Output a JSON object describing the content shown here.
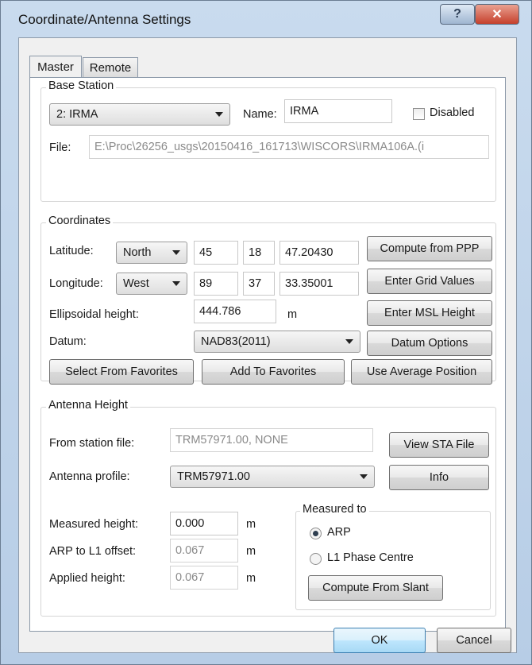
{
  "window": {
    "title": "Coordinate/Antenna Settings",
    "help_glyph": "?",
    "close_glyph": "✕"
  },
  "tabs": [
    {
      "label": "Master",
      "active": true
    },
    {
      "label": "Remote",
      "active": false
    }
  ],
  "base_station": {
    "group_label": "Base Station",
    "station_select": "2: IRMA",
    "name_label": "Name:",
    "name_value": "IRMA",
    "disabled_label": "Disabled",
    "disabled_checked": false,
    "file_label": "File:",
    "file_value": "E:\\Proc\\26256_usgs\\20150416_161713\\WISCORS\\IRMA106A.(i"
  },
  "coordinates": {
    "group_label": "Coordinates",
    "latitude_label": "Latitude:",
    "lat_hemisphere": "North",
    "lat_deg": "45",
    "lat_min": "18",
    "lat_sec": "47.20430",
    "longitude_label": "Longitude:",
    "lon_hemisphere": "West",
    "lon_deg": "89",
    "lon_min": "37",
    "lon_sec": "33.35001",
    "ellipsoidal_label": "Ellipsoidal height:",
    "ellipsoidal_value": "444.786",
    "ellipsoidal_unit": "m",
    "datum_label": "Datum:",
    "datum_value": "NAD83(2011)",
    "compute_ppp": "Compute from PPP",
    "enter_grid": "Enter Grid Values",
    "enter_msl": "Enter MSL Height",
    "datum_options": "Datum Options",
    "select_favorites": "Select From Favorites",
    "add_favorites": "Add To Favorites",
    "use_average": "Use Average Position"
  },
  "antenna": {
    "group_label": "Antenna Height",
    "from_station_label": "From station file:",
    "from_station_value": "TRM57971.00, NONE",
    "view_sta": "View STA File",
    "profile_label": "Antenna profile:",
    "profile_value": "TRM57971.00",
    "info": "Info",
    "measured_label": "Measured height:",
    "measured_value": "0.000",
    "arp_label": "ARP to L1 offset:",
    "arp_value": "0.067",
    "applied_label": "Applied height:",
    "applied_value": "0.067",
    "unit": "m",
    "measured_to_label": "Measured to",
    "radio_arp": "ARP",
    "radio_l1": "L1 Phase Centre",
    "radio_selected": "ARP",
    "compute_slant": "Compute From Slant"
  },
  "footer": {
    "ok": "OK",
    "cancel": "Cancel"
  }
}
